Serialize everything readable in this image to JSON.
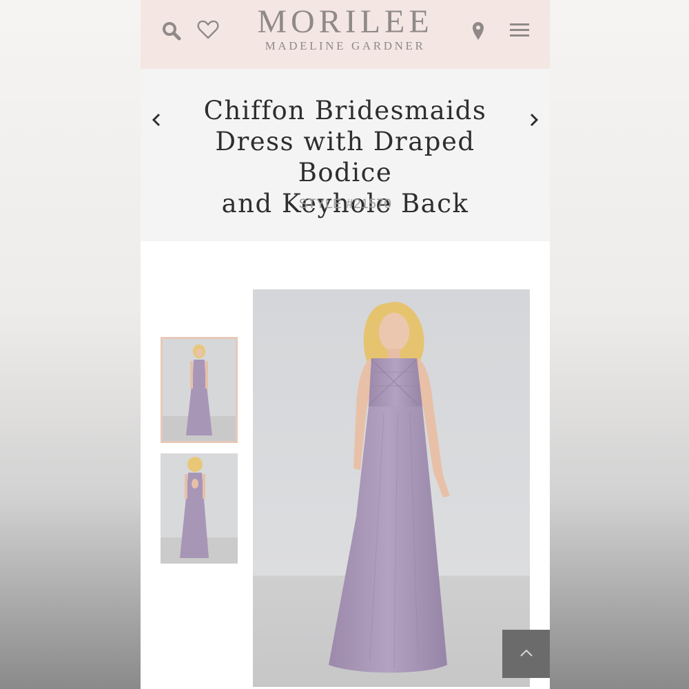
{
  "header": {
    "logo_main": "MORILEE",
    "logo_sub": "MADELINE GARDNER",
    "icons": [
      "search-icon",
      "heart-icon",
      "map-pin-icon",
      "hamburger-menu-icon"
    ],
    "background": "#f4e6e3"
  },
  "product": {
    "title_line1": "Chiffon Bridesmaids",
    "title_line2": "Dress with Draped Bodice",
    "title_line3": "and Keyhole Back",
    "style_number": "STYLE #21570",
    "nav_icons": [
      "chevron-left-icon",
      "chevron-right-icon"
    ]
  },
  "gallery": {
    "thumbnails": [
      {
        "view": "front",
        "selected": true
      },
      {
        "view": "back",
        "selected": false
      }
    ],
    "main_view": "front",
    "dress_color": "#a896b6",
    "selected_border_color": "#e7c8b8"
  },
  "scroll_top": {
    "icon": "chevron-up-icon"
  }
}
